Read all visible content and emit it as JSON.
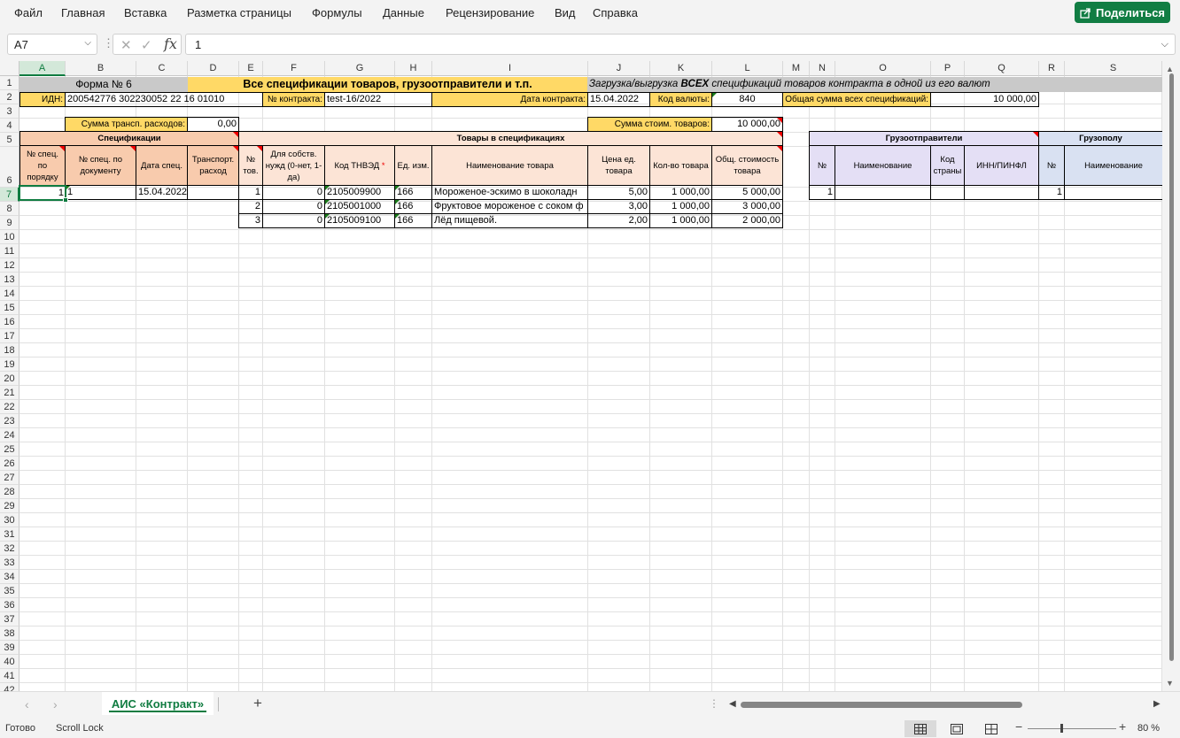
{
  "menu": {
    "items": [
      "Файл",
      "Главная",
      "Вставка",
      "Разметка страницы",
      "Формулы",
      "Данные",
      "Рецензирование",
      "Вид",
      "Справка"
    ],
    "share_label": "Поделиться"
  },
  "formula_bar": {
    "name_box": "A7",
    "fx": "fx",
    "value": "1"
  },
  "grid": {
    "columns": [
      "A",
      "B",
      "C",
      "D",
      "E",
      "F",
      "G",
      "H",
      "I",
      "J",
      "K",
      "L",
      "M",
      "N",
      "O",
      "P",
      "Q",
      "R",
      "S"
    ],
    "selected_column": "A",
    "rows": [
      "1",
      "2",
      "3",
      "4",
      "5",
      "6",
      "7",
      "8",
      "9",
      "10",
      "11",
      "12",
      "13",
      "14",
      "15",
      "16",
      "17",
      "18",
      "19",
      "20",
      "21",
      "22",
      "23",
      "24",
      "25",
      "26",
      "27",
      "28",
      "29",
      "30",
      "31",
      "32",
      "33",
      "34",
      "35",
      "36",
      "37",
      "38",
      "39",
      "40",
      "41",
      "42"
    ],
    "selected_row": "7"
  },
  "sheet": {
    "form_title": "Форма № 6",
    "main_title": "Все спецификации товаров, грузоотправители и т.п.",
    "load_note_pre": "Загрузка/выгрузка",
    "load_note_bold": "ВСЕХ",
    "load_note_post": "спецификаций товаров контракта в одной из его валют",
    "idn_label": "ИДН:",
    "idn_value": "200542776 302230052 22 16 01010",
    "contract_no_label": "№ контракта:",
    "contract_no_value": "test-16/2022",
    "contract_date_label": "Дата контракта:",
    "contract_date_value": "15.04.2022",
    "currency_label": "Код валюты:",
    "currency_value": "840",
    "total_all_label": "Общая сумма всех спецификаций:",
    "total_all_value": "10 000,00",
    "transport_sum_label": "Сумма трансп. расходов:",
    "transport_sum_value": "0,00",
    "goods_sum_label": "Сумма стоим. товаров:",
    "goods_sum_value": "10 000,00",
    "section_specs": "Спецификации",
    "section_goods": "Товары в спецификациях",
    "section_shippers": "Грузоотправители",
    "section_consignees": "Грузополу",
    "headers": {
      "a": "№ спец. по порядку",
      "b": "№ спец. по документу",
      "c": "Дата спец.",
      "d": "Транспорт. расход",
      "e": "№ тов.",
      "f": "Для собств. нужд (0-нет, 1-да)",
      "g": "Код ТНВЭД",
      "g_star": "*",
      "h": "Ед. изм.",
      "i": "Наименование товара",
      "j": "Цена ед. товара",
      "k": "Кол-во товара",
      "l": "Общ. стоимость товара",
      "n": "№",
      "o": "Наименование",
      "p": "Код страны",
      "q": "ИНН/ПИНФЛ",
      "r": "№",
      "s": "Наименование"
    },
    "spec_row": {
      "a": "1",
      "b": "1",
      "c": "15.04.2022"
    },
    "goods": [
      {
        "no": "1",
        "own": "0",
        "code": "2105009900",
        "unit": "166",
        "name": "Мороженое-эскимо в шоколадн",
        "price": "5,00",
        "qty": "1 000,00",
        "total": "5 000,00"
      },
      {
        "no": "2",
        "own": "0",
        "code": "2105001000",
        "unit": "166",
        "name": "Фруктовое мороженое с соком ф",
        "price": "3,00",
        "qty": "1 000,00",
        "total": "3 000,00"
      },
      {
        "no": "3",
        "own": "0",
        "code": "2105009100",
        "unit": "166",
        "name": "Лёд пищевой.",
        "price": "2,00",
        "qty": "1 000,00",
        "total": "2 000,00"
      }
    ],
    "shipper_row": {
      "no": "1"
    },
    "consignee_row": {
      "no": "1"
    }
  },
  "tabs": {
    "active": "АИС «Контракт»",
    "add": "+"
  },
  "status": {
    "ready": "Готово",
    "scroll_lock": "Scroll Lock",
    "zoom": "80 %"
  },
  "colors": {
    "accent_green": "#107c41",
    "share_green": "#117d43",
    "yellow_label": "#ffd966",
    "gray_header": "#c9c9c9",
    "specs_header": "#f8cbad",
    "goods_header": "#fce4d6",
    "shippers_header": "#e4dff5",
    "consignees_header": "#d9e1f2"
  }
}
